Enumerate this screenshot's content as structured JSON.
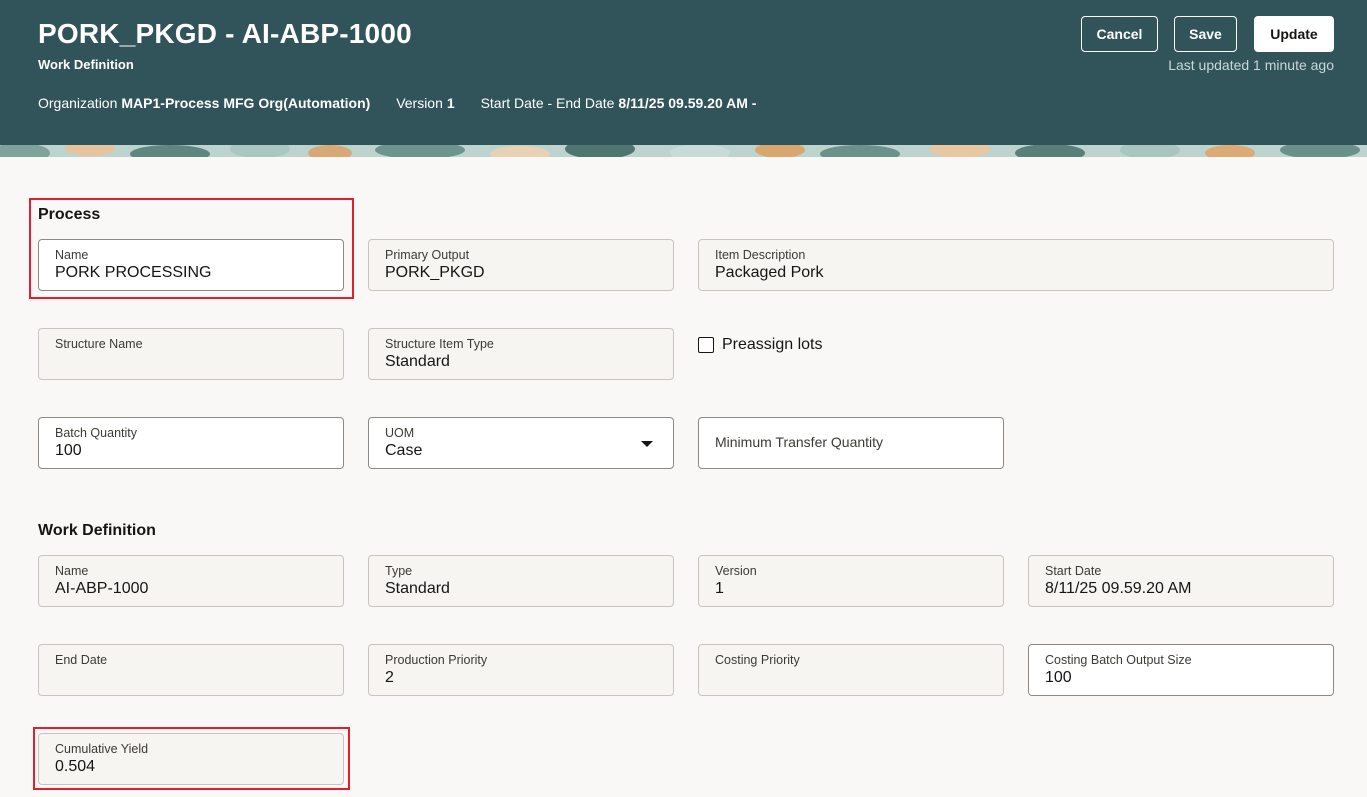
{
  "header": {
    "title": "PORK_PKGD - AI-ABP-1000",
    "subtitle": "Work Definition",
    "organization_label": "Organization",
    "organization_value": "MAP1-Process MFG Org(Automation)",
    "version_label": "Version",
    "version_value": "1",
    "dates_label": "Start Date - End Date",
    "dates_value": "8/11/25 09.59.20 AM -",
    "cancel_label": "Cancel",
    "save_label": "Save",
    "update_label": "Update",
    "last_updated": "Last updated 1 minute ago"
  },
  "process": {
    "section_title": "Process",
    "name": {
      "label": "Name",
      "value": "PORK PROCESSING"
    },
    "primary_output": {
      "label": "Primary Output",
      "value": "PORK_PKGD"
    },
    "item_description": {
      "label": "Item Description",
      "value": "Packaged Pork"
    },
    "structure_name": {
      "label": "Structure Name",
      "value": ""
    },
    "structure_item_type": {
      "label": "Structure Item Type",
      "value": "Standard"
    },
    "preassign_lots": {
      "label": "Preassign lots",
      "checked": false
    },
    "batch_quantity": {
      "label": "Batch Quantity",
      "value": "100"
    },
    "uom": {
      "label": "UOM",
      "value": "Case"
    },
    "minimum_transfer_quantity": {
      "label": "Minimum Transfer Quantity",
      "value": ""
    }
  },
  "work_definition": {
    "section_title": "Work Definition",
    "name": {
      "label": "Name",
      "value": "AI-ABP-1000"
    },
    "type": {
      "label": "Type",
      "value": "Standard"
    },
    "version": {
      "label": "Version",
      "value": "1"
    },
    "start_date": {
      "label": "Start Date",
      "value": "8/11/25 09.59.20 AM"
    },
    "end_date": {
      "label": "End Date",
      "value": ""
    },
    "production_priority": {
      "label": "Production Priority",
      "value": "2"
    },
    "costing_priority": {
      "label": "Costing Priority",
      "value": ""
    },
    "costing_batch_output_size": {
      "label": "Costing Batch Output Size",
      "value": "100"
    },
    "cumulative_yield": {
      "label": "Cumulative Yield",
      "value": "0.504"
    }
  },
  "colors": {
    "header_bg": "#31535a",
    "highlight": "#e0202e",
    "page_bg": "#f9f8f6"
  }
}
